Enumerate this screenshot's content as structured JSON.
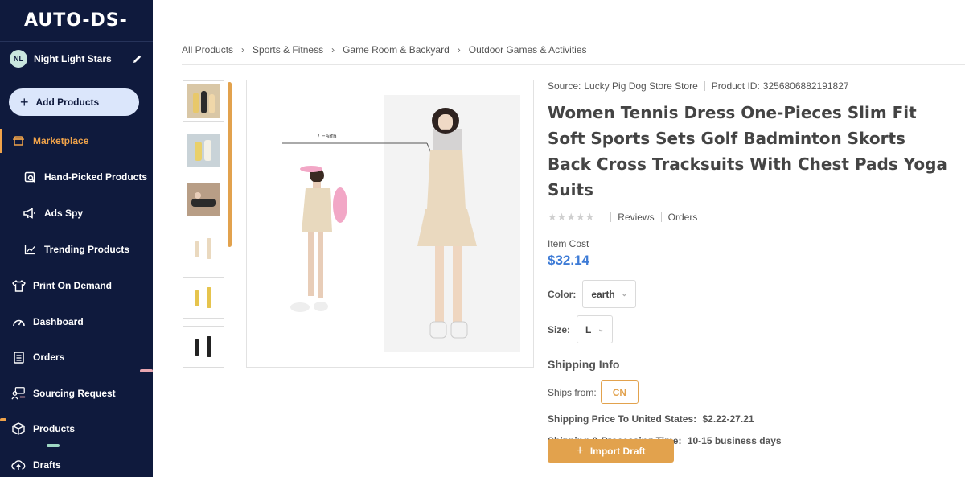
{
  "app": {
    "logo": "AUTO-DS-"
  },
  "store": {
    "initials": "NL",
    "name": "Night Light Stars"
  },
  "sidebar": {
    "add_products": "Add Products",
    "items": [
      {
        "label": "Marketplace",
        "icon": "store-icon"
      },
      {
        "label": "Hand-Picked Products",
        "icon": "search-doc-icon"
      },
      {
        "label": "Ads Spy",
        "icon": "megaphone-icon"
      },
      {
        "label": "Trending Products",
        "icon": "trend-chart-icon"
      },
      {
        "label": "Print On Demand",
        "icon": "tshirt-icon"
      },
      {
        "label": "Dashboard",
        "icon": "gauge-icon"
      },
      {
        "label": "Orders",
        "icon": "clipboard-icon"
      },
      {
        "label": "Sourcing Request",
        "icon": "sourcing-icon"
      },
      {
        "label": "Products",
        "icon": "box-icon"
      },
      {
        "label": "Drafts",
        "icon": "cloud-upload-icon"
      }
    ]
  },
  "breadcrumb": [
    "All Products",
    "Sports & Fitness",
    "Game Room & Backyard",
    "Outdoor Games & Activities"
  ],
  "product": {
    "source_label": "Source:",
    "source": "Lucky Pig Dog Store Store",
    "id_label": "Product ID:",
    "id": "3256806882191827",
    "title": "Women Tennis Dress One-Pieces Slim Fit Soft Sports Sets Golf Badminton Skorts Back Cross Tracksuits With Chest Pads Yoga Suits",
    "reviews_label": "Reviews",
    "orders_label": "Orders",
    "rating_stars": 0,
    "cost_label": "Item Cost",
    "cost": "$32.14",
    "color_label": "Color:",
    "color_value": "earth",
    "size_label": "Size:",
    "size_value": "L",
    "image_annotation": "/ Earth",
    "accent_color": "#e2a24d",
    "price_color": "#3d7bd6"
  },
  "shipping": {
    "heading": "Shipping Info",
    "from_label": "Ships from:",
    "from_value": "CN",
    "price_label": "Shipping Price To United States:",
    "price_value": "$2.22-27.21",
    "time_label": "Shipping & Processing Time:",
    "time_value": "10-15 business days"
  },
  "actions": {
    "import_draft": "Import Draft"
  }
}
